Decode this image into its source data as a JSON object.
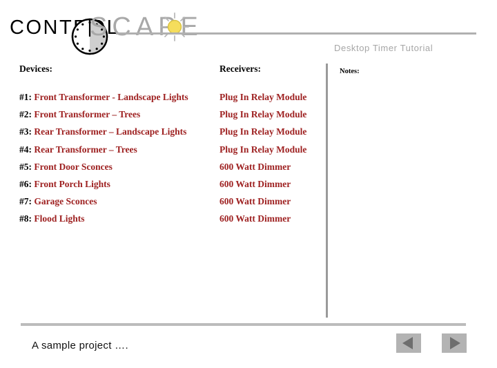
{
  "logo": {
    "word_dark": "CONTROL",
    "word_light": "SCAPE",
    "clock_icon": "sundial-clock-icon",
    "sun_icon": "sun-icon",
    "colors": {
      "dark_text": "#000000",
      "light_text": "#a8a8a8",
      "sun_fill": "#f5dd5c",
      "rule": "#b0b0b0"
    }
  },
  "header": {
    "tutorial_title": "Desktop Timer Tutorial"
  },
  "table": {
    "headers": {
      "devices": "Devices:",
      "receivers": "Receivers:",
      "notes": "Notes:"
    },
    "rows": [
      {
        "num": "#1:",
        "device": "Front Transformer - Landscape Lights",
        "receiver": "Plug In Relay Module"
      },
      {
        "num": "#2:",
        "device": "Front Transformer – Trees",
        "receiver": "Plug In Relay Module"
      },
      {
        "num": "#3:",
        "device": "Rear Transformer – Landscape Lights",
        "receiver": "Plug In Relay Module"
      },
      {
        "num": "#4:",
        "device": "Rear Transformer – Trees",
        "receiver": "Plug In Relay Module"
      },
      {
        "num": "#5:",
        "device": "Front Door Sconces",
        "receiver": "600 Watt Dimmer"
      },
      {
        "num": "#6:",
        "device": "Front Porch Lights",
        "receiver": "600 Watt Dimmer"
      },
      {
        "num": "#7:",
        "device": "Garage Sconces",
        "receiver": "600 Watt Dimmer"
      },
      {
        "num": "#8:",
        "device": "Flood Lights",
        "receiver": "600 Watt Dimmer"
      }
    ],
    "notes_value": "",
    "value_color": "#9e2121"
  },
  "footer": {
    "caption": "A sample project ….",
    "back_icon": "triangle-left-icon",
    "forward_icon": "triangle-right-icon",
    "button_color": "#b3b3b3",
    "rule_color": "#bcbcbc"
  }
}
